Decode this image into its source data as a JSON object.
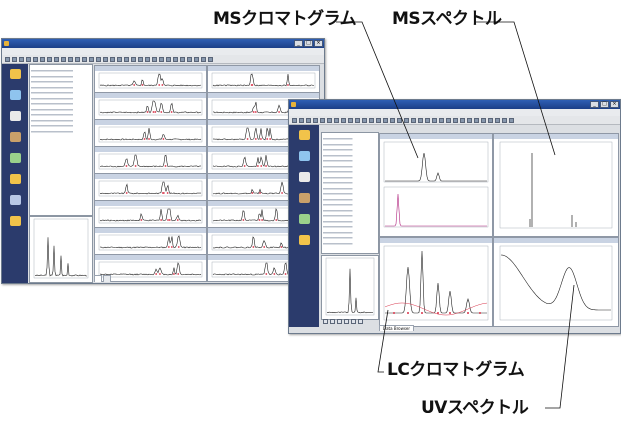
{
  "labels": {
    "ms_chromatogram": "MSクロマトグラム",
    "ms_spectrum": "MSスペクトル",
    "lc_chromatogram": "LCクロマトグラム",
    "uv_spectrum": "UVスペクトル"
  },
  "colors": {
    "label_text": "#111111",
    "sidebar": "#2b3b6c",
    "titlebar": "#2f5fb4",
    "trace": "#222222",
    "marker": "#d8344a",
    "ms_magenta": "#b0257f"
  },
  "back_window": {
    "tabs": [
      "",
      ""
    ]
  },
  "front_window": {
    "sidebar_items": [
      {
        "label": "",
        "icon": "data-browser-icon"
      },
      {
        "label": "",
        "icon": "open-data-icon"
      },
      {
        "label": "",
        "icon": "display-settings-icon"
      },
      {
        "label": "",
        "icon": "spectrum-icon"
      },
      {
        "label": "",
        "icon": "report-icon"
      },
      {
        "label": "",
        "icon": "export-icon"
      }
    ],
    "tabs": [
      "Data Browser"
    ]
  }
}
